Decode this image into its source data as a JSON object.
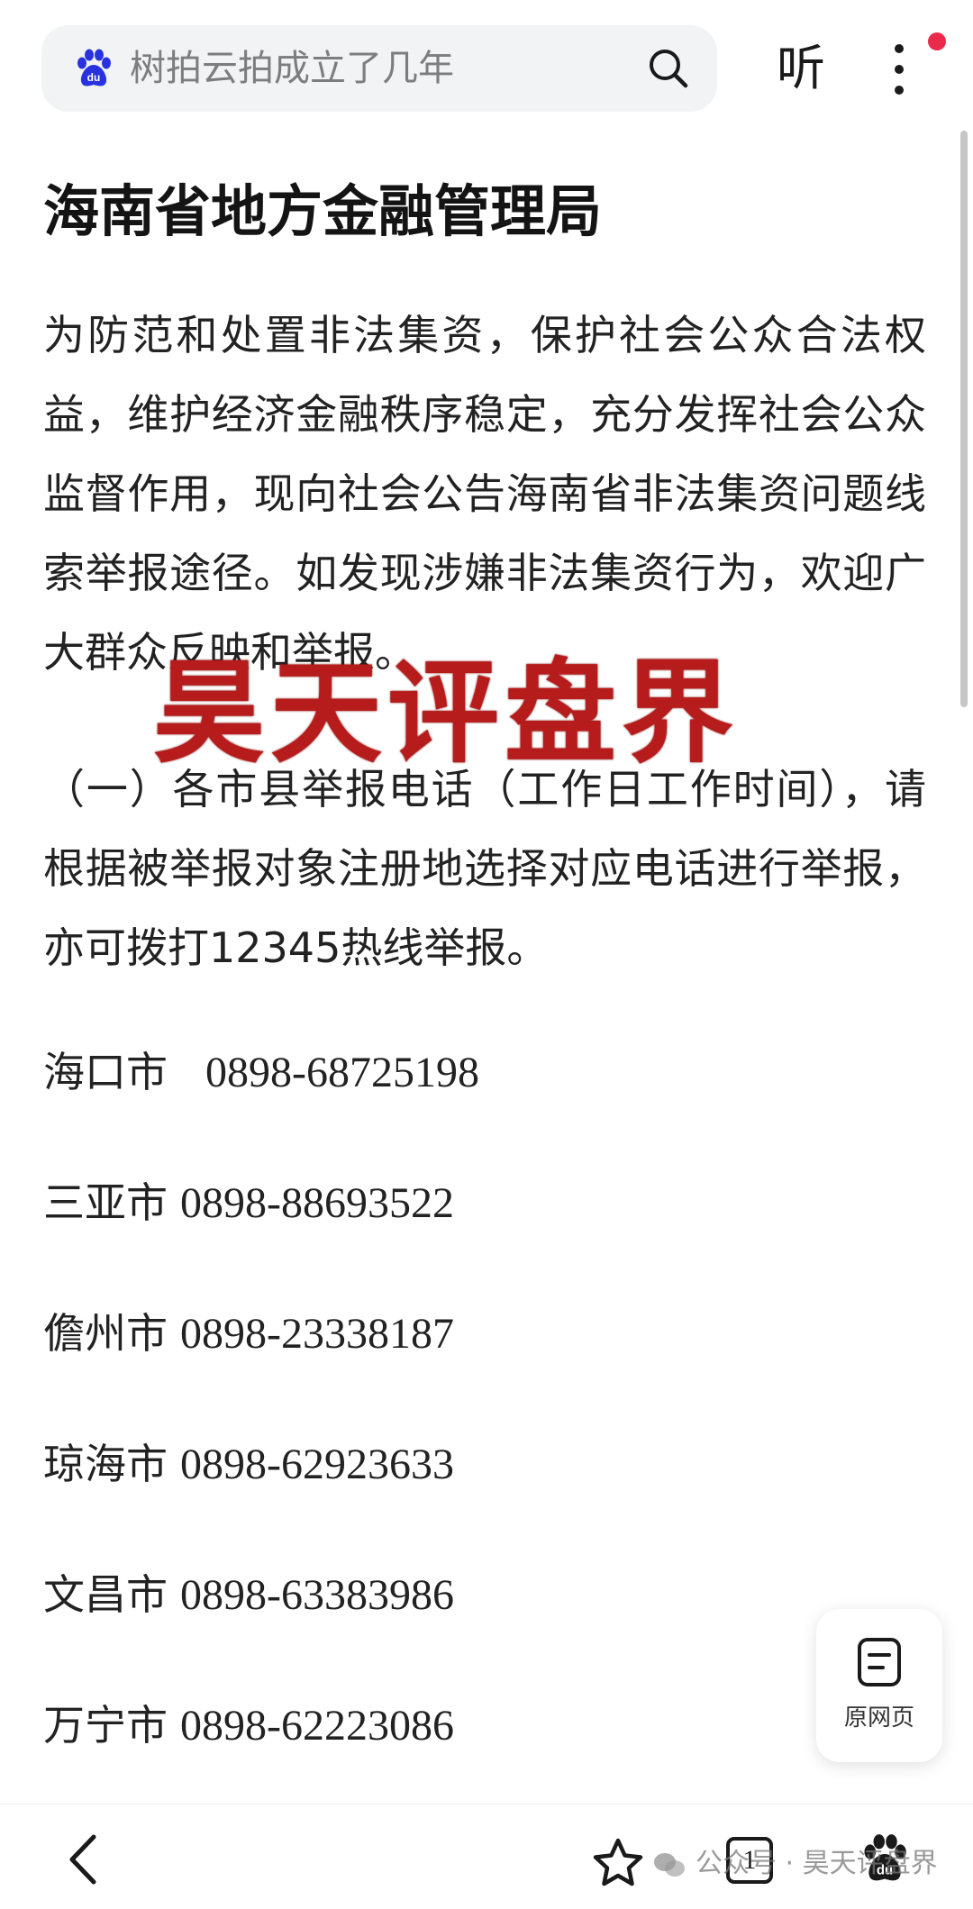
{
  "search": {
    "query": "树拍云拍成立了几年"
  },
  "header": {
    "listen_label": "听"
  },
  "article": {
    "title": "海南省地方金融管理局",
    "paragraph1": "为防范和处置非法集资，保护社会公众合法权益，维护经济金融秩序稳定，充分发挥社会公众监督作用，现向社会公告海南省非法集资问题线索举报途径。如发现涉嫌非法集资行为，欢迎广大群众反映和举报。",
    "paragraph2": "（一）各市县举报电话（工作日工作时间），请根据被举报对象注册地选择对应电话进行举报，亦可拨打12345热线举报。",
    "hotlines": [
      {
        "city": "海口市",
        "phone": "0898-68725198"
      },
      {
        "city": "三亚市",
        "phone": "0898-88693522"
      },
      {
        "city": "儋州市",
        "phone": "0898-23338187"
      },
      {
        "city": "琼海市",
        "phone": "0898-62923633"
      },
      {
        "city": "文昌市",
        "phone": "0898-63383986"
      },
      {
        "city": "万宁市",
        "phone": "0898-62223086"
      }
    ]
  },
  "watermark": {
    "text": "昊天评盘界"
  },
  "floating": {
    "original_page_label": "原网页"
  },
  "bottombar": {
    "tab_count": "1",
    "wechat_watermark": "公众号 · 昊天评盘界"
  },
  "colors": {
    "accent_red": "#b71c1c",
    "notify_dot": "#ea2b4b",
    "baidu_blue": "#2932e1"
  }
}
